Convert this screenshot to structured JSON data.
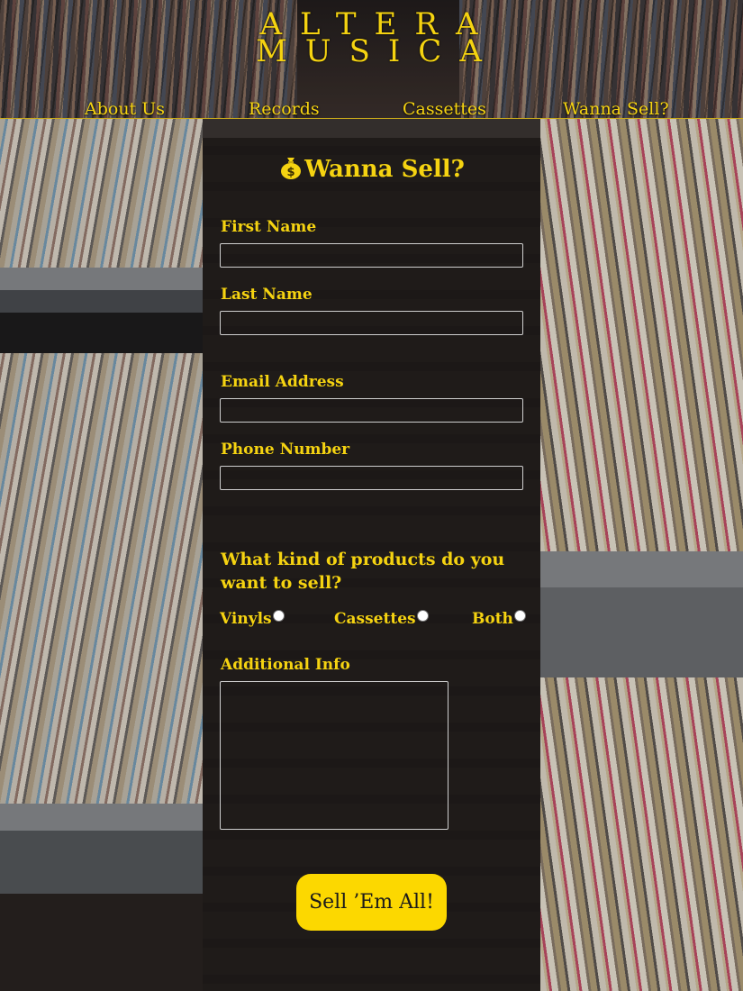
{
  "brand": {
    "line1": "ALTERA",
    "line2": "MUSICA"
  },
  "nav": [
    {
      "label": "About Us"
    },
    {
      "label": "Records"
    },
    {
      "label": "Cassettes"
    },
    {
      "label": "Wanna Sell?"
    }
  ],
  "form": {
    "title": "Wanna Sell?",
    "title_icon": "money-bag-icon",
    "first_name_label": "First Name",
    "first_name_value": "",
    "last_name_label": "Last Name",
    "last_name_value": "",
    "email_label": "Email Address",
    "email_value": "",
    "phone_label": "Phone Number",
    "phone_value": "",
    "question": "What kind of products do you want to sell?",
    "options": [
      {
        "label": "Vinyls",
        "selected": false
      },
      {
        "label": "Cassettes",
        "selected": false
      },
      {
        "label": "Both",
        "selected": false
      }
    ],
    "additional_label": "Additional Info",
    "additional_value": "",
    "submit_label": "Sell ’Em All!"
  },
  "colors": {
    "accent": "#f5d311",
    "button": "#fcd800",
    "panel": "#1a1615"
  }
}
